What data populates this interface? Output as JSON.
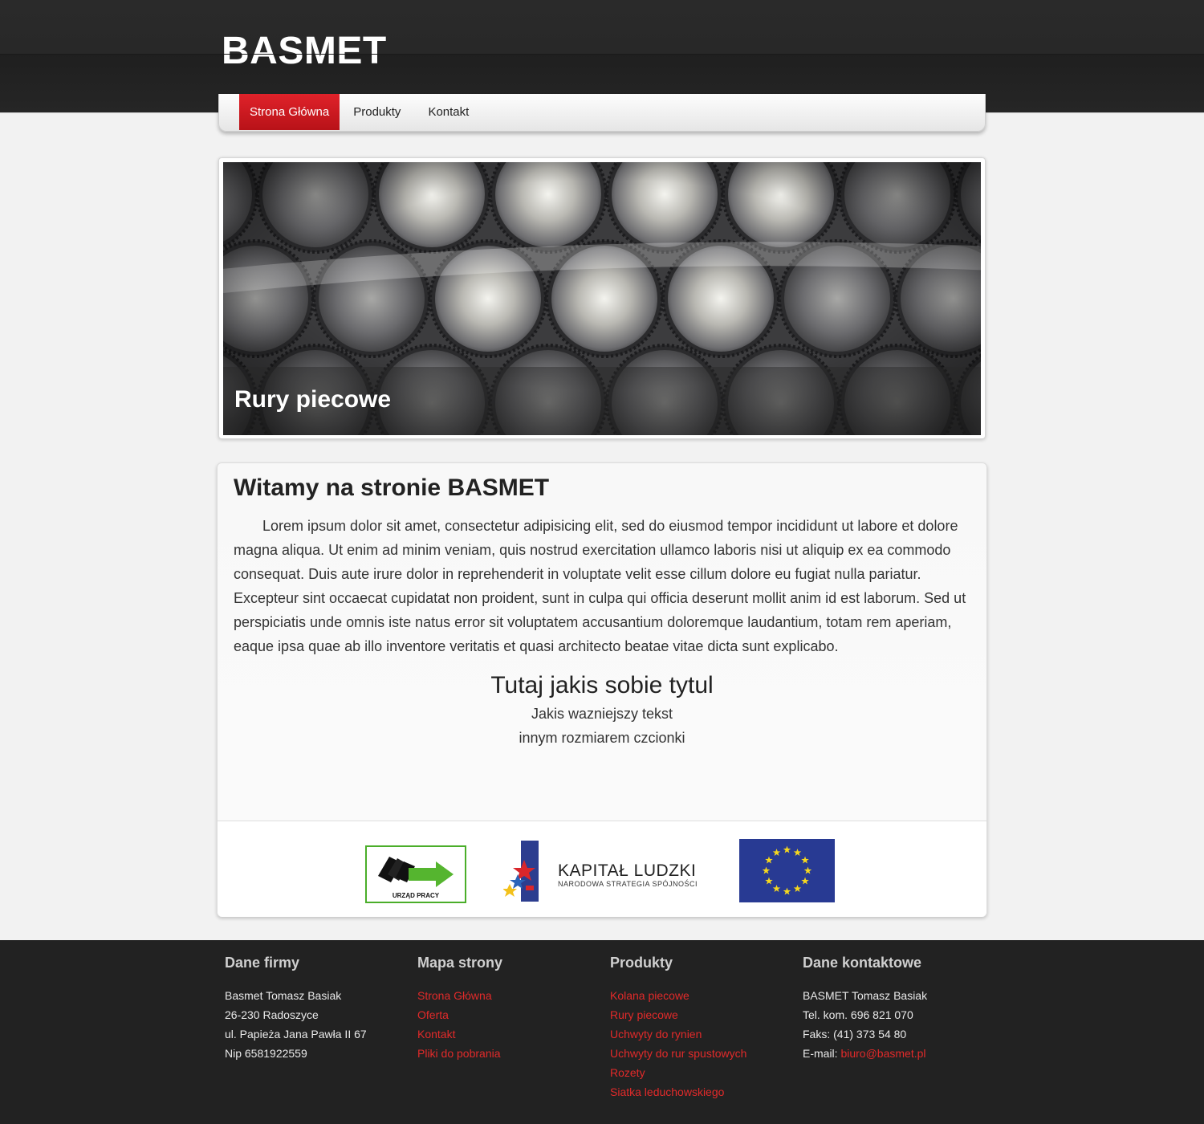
{
  "header": {
    "logo": "BASMET"
  },
  "nav": {
    "items": [
      {
        "label": "Strona Główna"
      },
      {
        "label": "Produkty"
      },
      {
        "label": "Kontakt"
      }
    ]
  },
  "slider": {
    "caption": "Rury piecowe"
  },
  "content": {
    "title": "Witamy na stronie BASMET",
    "paragraph": "Lorem ipsum dolor sit amet, consectetur adipisicing elit, sed do eiusmod tempor incididunt ut labore et dolore magna aliqua. Ut enim ad minim veniam, quis nostrud exercitation ullamco laboris nisi ut aliquip ex ea commodo consequat. Duis aute irure dolor in reprehenderit in voluptate velit esse cillum dolore eu fugiat nulla pariatur. Excepteur sint occaecat cupidatat non proident, sunt in culpa qui officia deserunt mollit anim id est laborum. Sed ut perspiciatis unde omnis iste natus error sit voluptatem accusantium doloremque laudantium, totam rem aperiam, eaque ipsa quae ab illo inventore veritatis et quasi architecto beatae vitae dicta sunt explicabo.",
    "center_title": "Tutaj jakis sobie tytul",
    "center_line1": "Jakis wazniejszy tekst",
    "center_line2": "innym rozmiarem czcionki"
  },
  "logos": {
    "urzad_pracy": "URZĄD PRACY",
    "kapital_title": "KAPITAŁ LUDZKI",
    "kapital_sub": "NARODOWA STRATEGIA SPÓJNOŚCI"
  },
  "footer": {
    "company": {
      "title": "Dane firmy",
      "lines": [
        "Basmet Tomasz Basiak",
        "26-230 Radoszyce",
        "ul. Papieża Jana Pawła II 67",
        "Nip 6581922559"
      ]
    },
    "sitemap": {
      "title": "Mapa strony",
      "links": [
        "Strona Główna",
        "Oferta",
        "Kontakt",
        "Pliki do pobrania"
      ]
    },
    "products": {
      "title": "Produkty",
      "links": [
        "Kolana piecowe",
        "Rury piecowe",
        "Uchwyty do rynien",
        "Uchwyty do rur spustowych",
        "Rozety",
        "Siatka leduchowskiego"
      ]
    },
    "contact": {
      "title": "Dane kontaktowe",
      "lines": [
        "BASMET Tomasz Basiak",
        "Tel. kom. 696 821 070",
        "Faks: (41) 373 54 80"
      ],
      "email_label": "E-mail: ",
      "email": "biuro@basmet.pl"
    }
  },
  "colors": {
    "accent": "#e22a2a",
    "nav_active": "#c8161d",
    "header_bg": "#262626",
    "footer_bg": "#222222"
  }
}
